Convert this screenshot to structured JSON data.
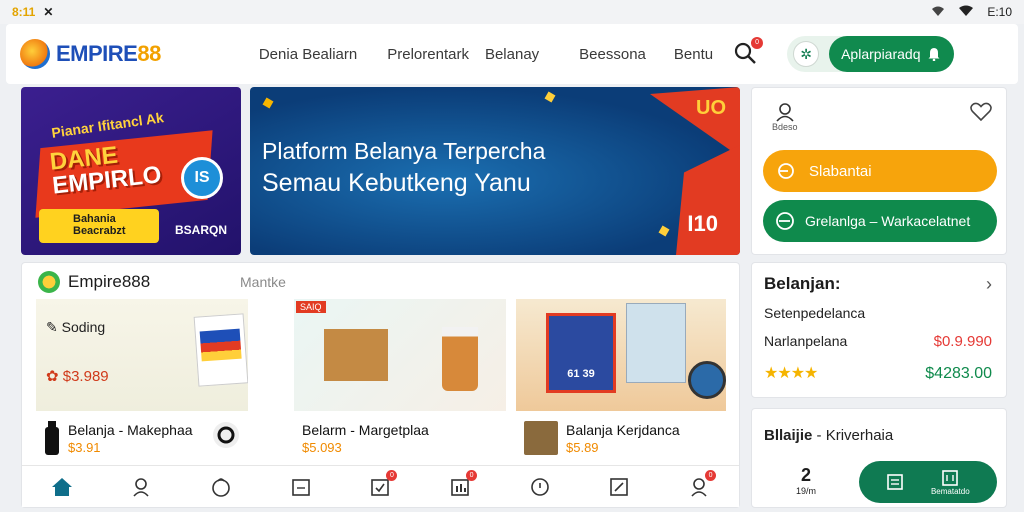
{
  "status_bar": {
    "time": "8:11",
    "right_text": "E:10"
  },
  "header": {
    "brand": "EMPIRE",
    "brand_accent": "88",
    "nav": [
      "Denia Bealiarn",
      "Prelorentark",
      "Belanay",
      "Beessona",
      "Bentu"
    ],
    "notification_count": "0",
    "account_label": "Aplarpiaradq"
  },
  "promo": {
    "top_text": "Pianar Ifitancl Ak",
    "title_line1": "DANE",
    "title_line2": "EMPIRLO",
    "coin": "IS",
    "yellow_text_1": "Bahania",
    "yellow_text_2": "Beacrabzt",
    "label": "BSARQN"
  },
  "hero": {
    "title_line1": "Platform Belanya Terpercha",
    "title_line2": "Semau Kebutkeng Yanu",
    "tag": "I10",
    "badge": "UO"
  },
  "account_card": {
    "user_caption": "Bdeso",
    "button_primary": "Slabantai",
    "button_secondary": "Grelanlga – Warkacelatnet"
  },
  "products": {
    "brand": "Empire888",
    "subtitle": "Mantke",
    "items": [
      {
        "name": "Belanja - Makephaa",
        "price": "$3.91",
        "img_label": "Soding",
        "img_price": "$3.989"
      },
      {
        "name": "Belarm - Margetplaa",
        "price": "$5.093",
        "img_label": "SAIQ",
        "img_price": ""
      },
      {
        "name": "Balanja Kerjdanca",
        "price": "$5.89",
        "img_label": "61 39",
        "img_price": ""
      }
    ]
  },
  "bottom_nav": {
    "items": [
      "home",
      "user",
      "bag",
      "calendar",
      "task",
      "chart",
      "chat",
      "edit",
      "profile"
    ],
    "badges": {
      "task": "0",
      "chart": "0",
      "profile": "0"
    }
  },
  "summary": {
    "title": "Belanjan:",
    "row1": "Setenpedelanca",
    "row2": "Narlanpelana",
    "price_red": "$0.9.990",
    "stars": "★★★★",
    "price_green": "$4283.00"
  },
  "bottom_card": {
    "title_bold": "Bllaijie",
    "title_rest": " - Kriverhaia",
    "count": "2",
    "count_caption": "19/m",
    "seg1": "",
    "seg2": "Bematatdo"
  }
}
